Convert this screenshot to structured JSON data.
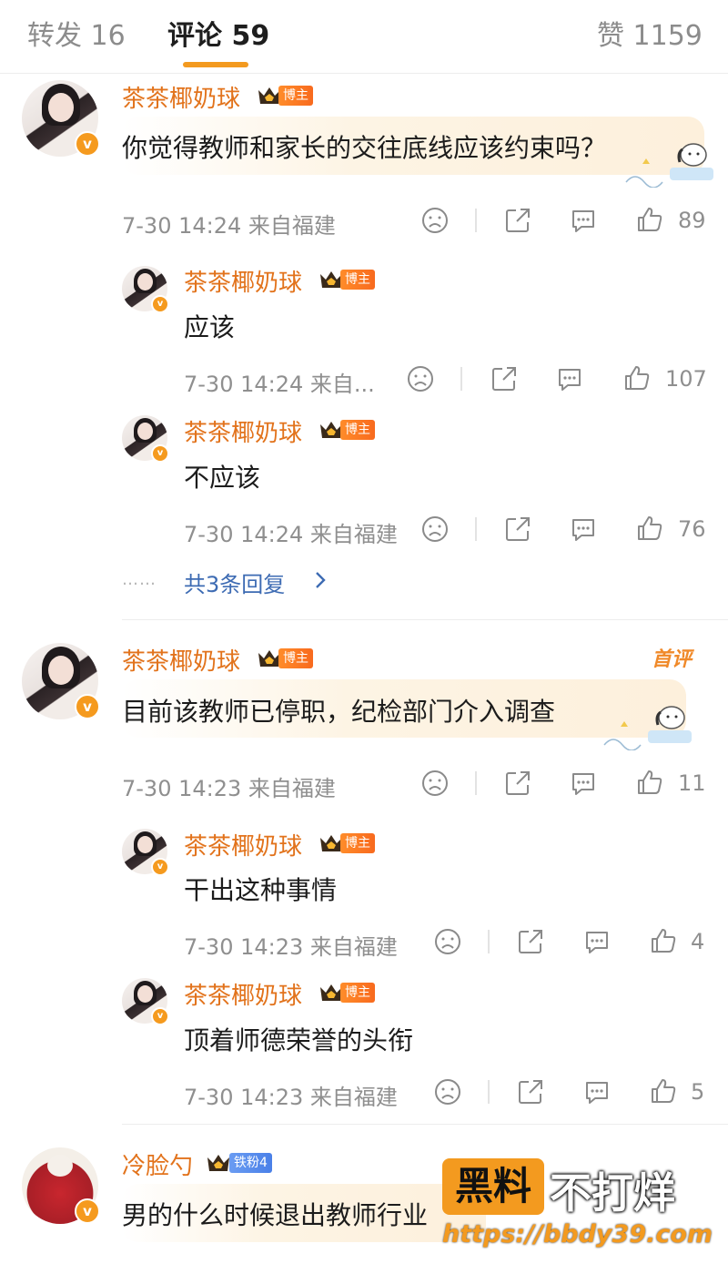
{
  "tabs": {
    "repost": "转发 16",
    "comments": "评论 59",
    "likes": "赞 1159"
  },
  "colors": {
    "accent": "#f39a1f",
    "username": "#e2731c",
    "reply_link": "#3d6bb3",
    "meta": "#8f8f8f"
  },
  "icons": [
    "frown-icon",
    "share-icon",
    "comment-icon",
    "thumbs-up-icon",
    "verified-v-icon",
    "crown-icon",
    "chevron-right-icon"
  ],
  "comments": [
    {
      "user": "茶茶椰奶球",
      "tag": "博主",
      "text": "你觉得教师和家长的交往底线应该约束吗？",
      "meta": "7-30 14:24 来自福建",
      "likes": "89",
      "replies": [
        {
          "user": "茶茶椰奶球",
          "tag": "博主",
          "text": "应该",
          "meta": "7-30 14:24 来自...",
          "likes": "107"
        },
        {
          "user": "茶茶椰奶球",
          "tag": "博主",
          "text": "不应该",
          "meta": "7-30 14:24 来自福建",
          "likes": "76"
        }
      ],
      "more_dots": "……",
      "more_label": "共3条回复"
    },
    {
      "user": "茶茶椰奶球",
      "tag": "博主",
      "badge": "首评",
      "text": "目前该教师已停职，纪检部门介入调查",
      "meta": "7-30 14:23 来自福建",
      "likes": "11",
      "replies": [
        {
          "user": "茶茶椰奶球",
          "tag": "博主",
          "text": "干出这种事情",
          "meta": "7-30 14:23 来自福建",
          "likes": "4"
        },
        {
          "user": "茶茶椰奶球",
          "tag": "博主",
          "text": "顶着师德荣誉的头衔",
          "meta": "7-30 14:23 来自福建",
          "likes": "5"
        }
      ]
    },
    {
      "user": "冷脸勺",
      "tag": "铁粉4",
      "text": "男的什么时候退出教师行业"
    }
  ],
  "watermark": {
    "box": "黑料",
    "text": "不打烊",
    "url": "https://bbdy39.com"
  }
}
